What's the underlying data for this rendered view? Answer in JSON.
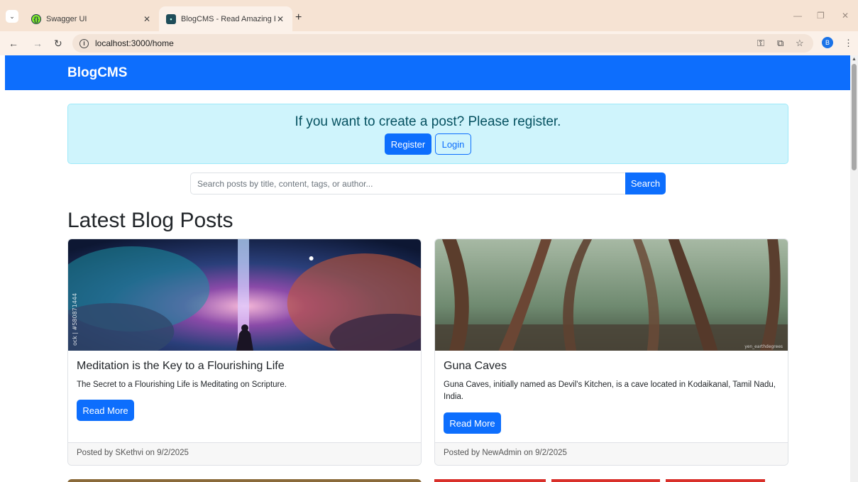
{
  "browser": {
    "tabs": [
      {
        "title": "Swagger UI",
        "active": false
      },
      {
        "title": "BlogCMS - Read Amazing Blog",
        "active": true
      }
    ],
    "url": "localhost:3000/home",
    "profile_initial": "B"
  },
  "navbar": {
    "brand": "BlogCMS"
  },
  "alert": {
    "message": "If you want to create a post? Please register.",
    "register_label": "Register",
    "login_label": "Login"
  },
  "search": {
    "placeholder": "Search posts by title, content, tags, or author...",
    "button_label": "Search"
  },
  "main": {
    "heading": "Latest Blog Posts",
    "read_more_label": "Read More",
    "posts": [
      {
        "title": "Meditation is the Key to a Flourishing Life",
        "excerpt": "The Secret to a Flourishing Life is Meditating on Scripture.",
        "footer": "Posted by SKethvi on 9/2/2025",
        "image_watermark": "ock | #580871444"
      },
      {
        "title": "Guna Caves",
        "excerpt": "Guna Caves, initially named as Devil's Kitchen, is a cave located in Kodaikanal, Tamil Nadu, India.",
        "footer": "Posted by NewAdmin on 9/2/2025",
        "image_watermark": "yen_earthdegrees"
      }
    ]
  },
  "colors": {
    "primary": "#0d6efd",
    "alert_bg": "#cff4fc",
    "alert_text": "#055160",
    "tabstrip": "#f6e3d3"
  }
}
